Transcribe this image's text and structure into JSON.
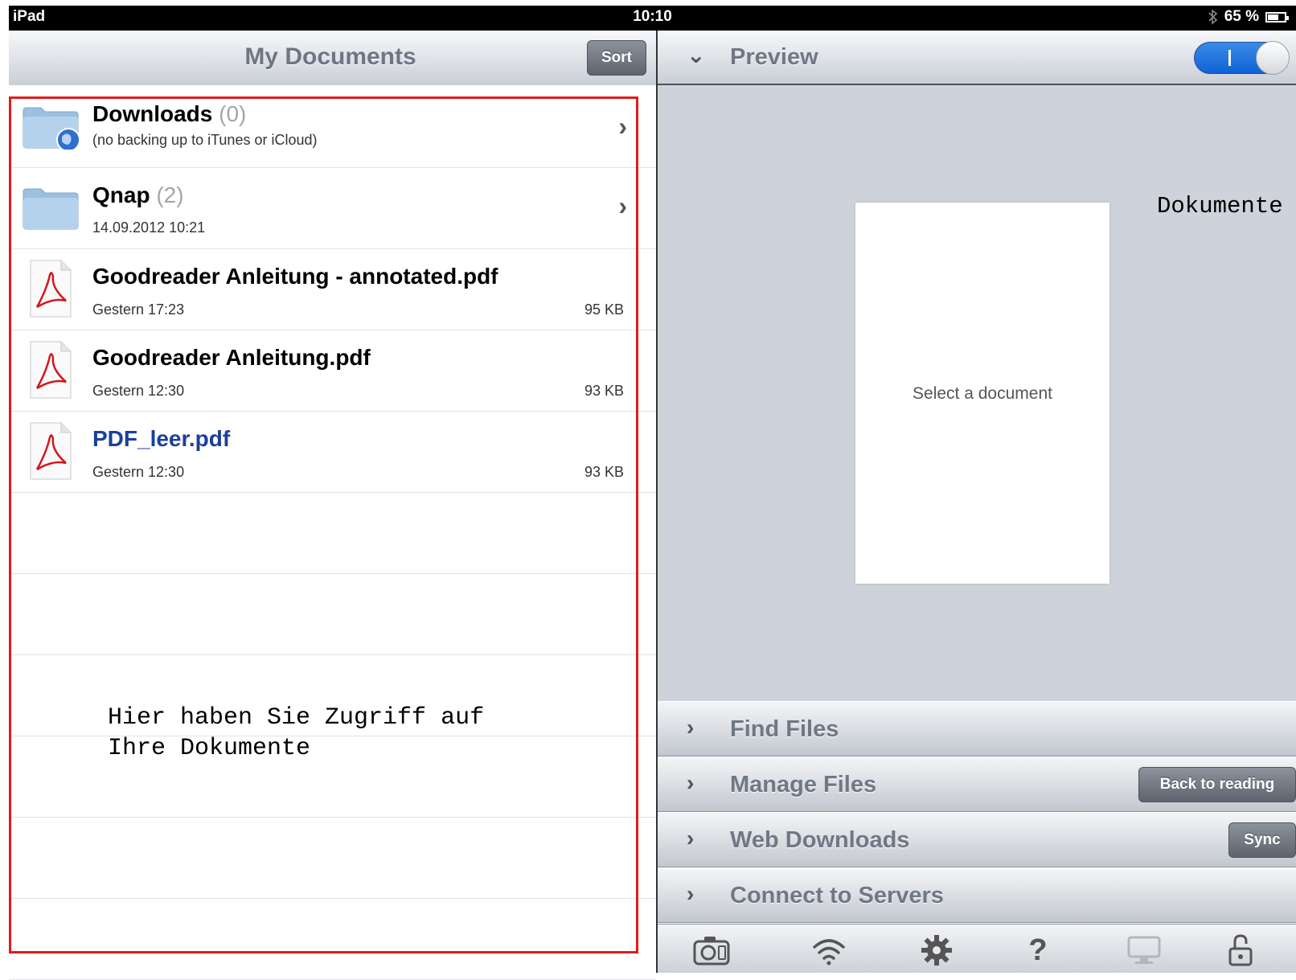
{
  "status_bar": {
    "carrier": "iPad",
    "time": "10:10",
    "battery": "65 %"
  },
  "left_header": {
    "title": "My Documents",
    "sort_label": "Sort"
  },
  "files": [
    {
      "name": "Downloads",
      "count": "(0)",
      "subtitle": "(no backing up to iTunes or iCloud)",
      "size": "",
      "type": "folder-globe"
    },
    {
      "name": "Qnap",
      "count": "(2)",
      "subtitle": "14.09.2012 10:21",
      "size": "",
      "type": "folder"
    },
    {
      "name": "Goodreader Anleitung - annotated.pdf",
      "count": "",
      "subtitle": "Gestern 17:23",
      "size": "95 KB",
      "type": "pdf"
    },
    {
      "name": "Goodreader Anleitung.pdf",
      "count": "",
      "subtitle": "Gestern 12:30",
      "size": "93 KB",
      "type": "pdf"
    },
    {
      "name": "PDF_leer.pdf",
      "count": "",
      "subtitle": "Gestern 12:30",
      "size": "93 KB",
      "type": "pdf"
    }
  ],
  "annotation": {
    "left_text": "Hier haben Sie Zugriff auf\nIhre Dokumente",
    "right_text": "Dokumente",
    "box_color": "#e21b1b"
  },
  "preview": {
    "title": "Preview",
    "placeholder": "Select a document",
    "toggle_on": true
  },
  "sections": {
    "find": "Find Files",
    "manage": "Manage Files",
    "manage_button": "Back to reading",
    "web": "Web Downloads",
    "web_button": "Sync",
    "connect": "Connect to Servers"
  },
  "toolbar": {
    "icons": [
      "camera-icon",
      "wifi-icon",
      "gear-icon",
      "help-icon",
      "monitor-icon",
      "unlock-icon"
    ],
    "help_glyph": "?"
  },
  "colors": {
    "link": "#1b3f9c",
    "accent_toggle": "#1f6fe0"
  }
}
